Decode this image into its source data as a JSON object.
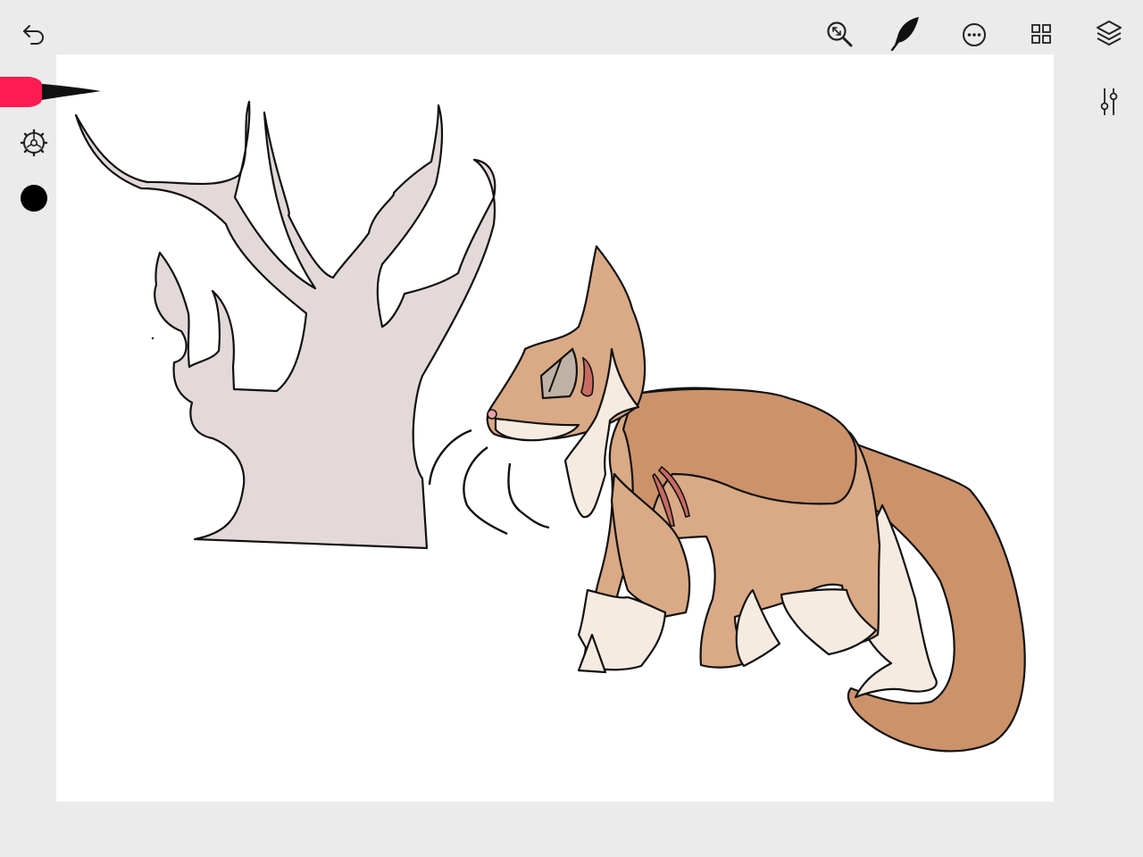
{
  "toolbar": {
    "undo_icon": "undo-arrow-icon",
    "zoom_icon": "zoom-fit-icon",
    "brush_icon": "feather-brush-icon",
    "more_icon": "more-dots-icon",
    "gallery_icon": "grid-icon",
    "layers_icon": "layers-icon",
    "adjust_icon": "sliders-icon"
  },
  "left_rail": {
    "brush_color": "#ff1a4f",
    "settings_icon": "gear-icon",
    "current_color": "#000000"
  },
  "canvas": {
    "background": "#ffffff",
    "palette": {
      "tree_fill": "#e3d9d9",
      "fox_body": "#d9aa85",
      "fox_dark": "#cc926a",
      "fox_cream": "#f5ebe1",
      "wound": "#c96a64"
    }
  }
}
